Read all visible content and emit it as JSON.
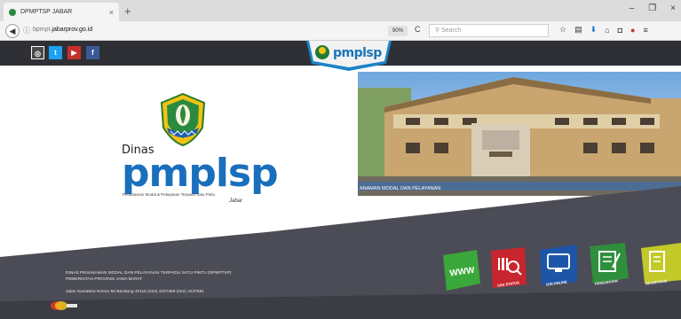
{
  "browser": {
    "tab_title": "DPMPTSP JABAR",
    "tab_close": "×",
    "new_tab": "+",
    "window_controls": [
      "–",
      "❐",
      "×"
    ],
    "url_prefix": "bpmpt.",
    "url_domain": "jabarprov.go.id",
    "zoom": "90%",
    "search_placeholder": "Search",
    "reload": "C",
    "toolbar_icons": [
      "star-icon",
      "library-icon",
      "download-icon",
      "home-icon",
      "pocket-icon",
      "adblock-icon",
      "menu-icon"
    ]
  },
  "header": {
    "social": [
      {
        "name": "instagram",
        "glyph": "◎",
        "color": "#555555"
      },
      {
        "name": "twitter",
        "glyph": "t",
        "color": "#1da1f2"
      },
      {
        "name": "youtube",
        "glyph": "▶",
        "color": "#c4302b"
      },
      {
        "name": "facebook",
        "glyph": "f",
        "color": "#3b5998"
      }
    ],
    "logo_text": "pmplsp"
  },
  "hero": {
    "dinas": "Dinas",
    "brand": "pmplsp",
    "tagline": "Penanaman Modal & Pelayanan Terpadu Satu Pintu",
    "region": "Jabar",
    "photo_caption": "ANAMAN MODAL DAN PELAYANAN"
  },
  "footer": {
    "line1": "DINAS PENANAMAN MODAL DAN PELAYANAN TERPADU SATU PINTU (DPMPTSP)",
    "line2": "PEMERINTAH PROVINSI JAWA BARAT",
    "line3": "Jalan Sumatera Nomor 50 Bandung 40115 (022) 4237369 (022) 4237581"
  },
  "menu": [
    {
      "name": "www",
      "label": "WWW",
      "color": "#3aa83a"
    },
    {
      "name": "cek-status",
      "label": "CEK STATUS",
      "color": "#c8262e"
    },
    {
      "name": "izin-online",
      "label": "IZIN ONLINE",
      "color": "#1d56a8"
    },
    {
      "name": "pengaduan",
      "label": "PENGADUAN",
      "color": "#2e8f3c"
    },
    {
      "name": "registrasi",
      "label": "REGISTRASI",
      "color": "#c3c928"
    }
  ],
  "colors": {
    "header": "#2f3035",
    "footer": "#4b4c55",
    "brand": "#1a6fbd"
  }
}
